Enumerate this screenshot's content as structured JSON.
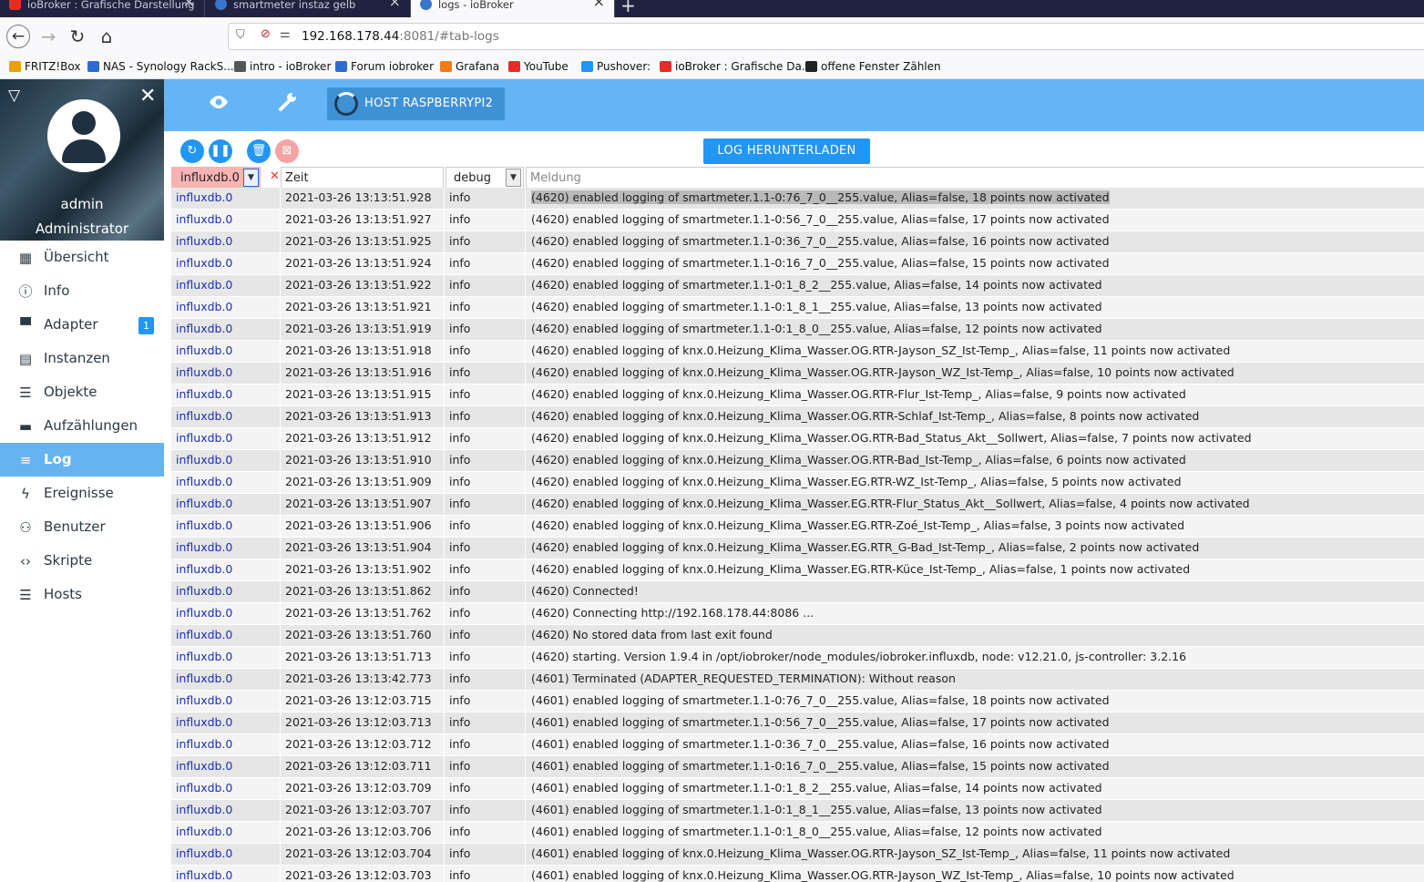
{
  "browser": {
    "tabs": [
      {
        "title": "ioBroker : Grafische Darstellung",
        "icon": "youtube-icon"
      },
      {
        "title": "smartmeter instaz gelb",
        "icon": "iobroker-icon"
      },
      {
        "title": "logs - ioBroker",
        "icon": "iobroker-icon"
      }
    ],
    "url_host": "192.168.178.44",
    "url_rest": ":8081/#tab-logs",
    "bookmarks": [
      {
        "label": "FRITZ!Box",
        "icon": "fritzbox-icon",
        "color": "#e8a100"
      },
      {
        "label": "NAS - Synology RackS...",
        "icon": "dsm-icon",
        "color": "#2d6bd1"
      },
      {
        "label": "intro - ioBroker",
        "icon": "globe-icon",
        "color": "#555555"
      },
      {
        "label": "Forum iobroker",
        "icon": "iobroker-icon",
        "color": "#2d6bd1"
      },
      {
        "label": "Grafana",
        "icon": "grafana-icon",
        "color": "#f07b1b"
      },
      {
        "label": "YouTube",
        "icon": "youtube-icon",
        "color": "#e52d27"
      },
      {
        "label": "Pushover:",
        "icon": "pushover-icon",
        "color": "#2196f3"
      },
      {
        "label": "ioBroker : Grafische Da...",
        "icon": "youtube-icon",
        "color": "#e52d27"
      },
      {
        "label": "offene Fenster Zählen",
        "icon": "github-icon",
        "color": "#222222"
      }
    ]
  },
  "sidebar": {
    "user": "admin",
    "role": "Administrator",
    "items": [
      {
        "label": "Übersicht",
        "icon": "grid-icon"
      },
      {
        "label": "Info",
        "icon": "info-icon"
      },
      {
        "label": "Adapter",
        "icon": "store-icon",
        "badge": "1"
      },
      {
        "label": "Instanzen",
        "icon": "instances-icon"
      },
      {
        "label": "Objekte",
        "icon": "list-icon"
      },
      {
        "label": "Aufzählungen",
        "icon": "enum-icon"
      },
      {
        "label": "Log",
        "icon": "log-icon",
        "active": true
      },
      {
        "label": "Ereignisse",
        "icon": "flash-icon"
      },
      {
        "label": "Benutzer",
        "icon": "user-icon"
      },
      {
        "label": "Skripte",
        "icon": "code-icon"
      },
      {
        "label": "Hosts",
        "icon": "hosts-icon"
      }
    ]
  },
  "appbar": {
    "host_label": "HOST RASPBERRYPI2"
  },
  "toolbar": {
    "download_label": "LOG HERUNTERLADEN"
  },
  "filters": {
    "source": "influxdb.0",
    "time_placeholder": "Zeit",
    "level": "debug",
    "message_placeholder": "Meldung"
  },
  "logs": [
    {
      "source": "influxdb.0",
      "time": "2021-03-26 13:13:51.928",
      "level": "info",
      "message": "(4620) enabled logging of smartmeter.1.1-0:76_7_0__255.value, Alias=false, 18 points now activated"
    },
    {
      "source": "influxdb.0",
      "time": "2021-03-26 13:13:51.927",
      "level": "info",
      "message": "(4620) enabled logging of smartmeter.1.1-0:56_7_0__255.value, Alias=false, 17 points now activated"
    },
    {
      "source": "influxdb.0",
      "time": "2021-03-26 13:13:51.925",
      "level": "info",
      "message": "(4620) enabled logging of smartmeter.1.1-0:36_7_0__255.value, Alias=false, 16 points now activated"
    },
    {
      "source": "influxdb.0",
      "time": "2021-03-26 13:13:51.924",
      "level": "info",
      "message": "(4620) enabled logging of smartmeter.1.1-0:16_7_0__255.value, Alias=false, 15 points now activated"
    },
    {
      "source": "influxdb.0",
      "time": "2021-03-26 13:13:51.922",
      "level": "info",
      "message": "(4620) enabled logging of smartmeter.1.1-0:1_8_2__255.value, Alias=false, 14 points now activated"
    },
    {
      "source": "influxdb.0",
      "time": "2021-03-26 13:13:51.921",
      "level": "info",
      "message": "(4620) enabled logging of smartmeter.1.1-0:1_8_1__255.value, Alias=false, 13 points now activated"
    },
    {
      "source": "influxdb.0",
      "time": "2021-03-26 13:13:51.919",
      "level": "info",
      "message": "(4620) enabled logging of smartmeter.1.1-0:1_8_0__255.value, Alias=false, 12 points now activated"
    },
    {
      "source": "influxdb.0",
      "time": "2021-03-26 13:13:51.918",
      "level": "info",
      "message": "(4620) enabled logging of knx.0.Heizung_Klima_Wasser.OG.RTR-Jayson_SZ_Ist-Temp_, Alias=false, 11 points now activated"
    },
    {
      "source": "influxdb.0",
      "time": "2021-03-26 13:13:51.916",
      "level": "info",
      "message": "(4620) enabled logging of knx.0.Heizung_Klima_Wasser.OG.RTR-Jayson_WZ_Ist-Temp_, Alias=false, 10 points now activated"
    },
    {
      "source": "influxdb.0",
      "time": "2021-03-26 13:13:51.915",
      "level": "info",
      "message": "(4620) enabled logging of knx.0.Heizung_Klima_Wasser.OG.RTR-Flur_Ist-Temp_, Alias=false, 9 points now activated"
    },
    {
      "source": "influxdb.0",
      "time": "2021-03-26 13:13:51.913",
      "level": "info",
      "message": "(4620) enabled logging of knx.0.Heizung_Klima_Wasser.OG.RTR-Schlaf_Ist-Temp_, Alias=false, 8 points now activated"
    },
    {
      "source": "influxdb.0",
      "time": "2021-03-26 13:13:51.912",
      "level": "info",
      "message": "(4620) enabled logging of knx.0.Heizung_Klima_Wasser.OG.RTR-Bad_Status_Akt__Sollwert, Alias=false, 7 points now activated"
    },
    {
      "source": "influxdb.0",
      "time": "2021-03-26 13:13:51.910",
      "level": "info",
      "message": "(4620) enabled logging of knx.0.Heizung_Klima_Wasser.OG.RTR-Bad_Ist-Temp_, Alias=false, 6 points now activated"
    },
    {
      "source": "influxdb.0",
      "time": "2021-03-26 13:13:51.909",
      "level": "info",
      "message": "(4620) enabled logging of knx.0.Heizung_Klima_Wasser.EG.RTR-WZ_Ist-Temp_, Alias=false, 5 points now activated"
    },
    {
      "source": "influxdb.0",
      "time": "2021-03-26 13:13:51.907",
      "level": "info",
      "message": "(4620) enabled logging of knx.0.Heizung_Klima_Wasser.EG.RTR-Flur_Status_Akt__Sollwert, Alias=false, 4 points now activated"
    },
    {
      "source": "influxdb.0",
      "time": "2021-03-26 13:13:51.906",
      "level": "info",
      "message": "(4620) enabled logging of knx.0.Heizung_Klima_Wasser.EG.RTR-Zoé_Ist-Temp_, Alias=false, 3 points now activated"
    },
    {
      "source": "influxdb.0",
      "time": "2021-03-26 13:13:51.904",
      "level": "info",
      "message": "(4620) enabled logging of knx.0.Heizung_Klima_Wasser.EG.RTR_G-Bad_Ist-Temp_, Alias=false, 2 points now activated"
    },
    {
      "source": "influxdb.0",
      "time": "2021-03-26 13:13:51.902",
      "level": "info",
      "message": "(4620) enabled logging of knx.0.Heizung_Klima_Wasser.EG.RTR-Küce_Ist-Temp_, Alias=false, 1 points now activated"
    },
    {
      "source": "influxdb.0",
      "time": "2021-03-26 13:13:51.862",
      "level": "info",
      "message": "(4620) Connected!"
    },
    {
      "source": "influxdb.0",
      "time": "2021-03-26 13:13:51.762",
      "level": "info",
      "message": "(4620) Connecting http://192.168.178.44:8086 ..."
    },
    {
      "source": "influxdb.0",
      "time": "2021-03-26 13:13:51.760",
      "level": "info",
      "message": "(4620) No stored data from last exit found"
    },
    {
      "source": "influxdb.0",
      "time": "2021-03-26 13:13:51.713",
      "level": "info",
      "message": "(4620) starting. Version 1.9.4 in /opt/iobroker/node_modules/iobroker.influxdb, node: v12.21.0, js-controller: 3.2.16"
    },
    {
      "source": "influxdb.0",
      "time": "2021-03-26 13:13:42.773",
      "level": "info",
      "message": "(4601) Terminated (ADAPTER_REQUESTED_TERMINATION): Without reason"
    },
    {
      "source": "influxdb.0",
      "time": "2021-03-26 13:12:03.715",
      "level": "info",
      "message": "(4601) enabled logging of smartmeter.1.1-0:76_7_0__255.value, Alias=false, 18 points now activated"
    },
    {
      "source": "influxdb.0",
      "time": "2021-03-26 13:12:03.713",
      "level": "info",
      "message": "(4601) enabled logging of smartmeter.1.1-0:56_7_0__255.value, Alias=false, 17 points now activated"
    },
    {
      "source": "influxdb.0",
      "time": "2021-03-26 13:12:03.712",
      "level": "info",
      "message": "(4601) enabled logging of smartmeter.1.1-0:36_7_0__255.value, Alias=false, 16 points now activated"
    },
    {
      "source": "influxdb.0",
      "time": "2021-03-26 13:12:03.711",
      "level": "info",
      "message": "(4601) enabled logging of smartmeter.1.1-0:16_7_0__255.value, Alias=false, 15 points now activated"
    },
    {
      "source": "influxdb.0",
      "time": "2021-03-26 13:12:03.709",
      "level": "info",
      "message": "(4601) enabled logging of smartmeter.1.1-0:1_8_2__255.value, Alias=false, 14 points now activated"
    },
    {
      "source": "influxdb.0",
      "time": "2021-03-26 13:12:03.707",
      "level": "info",
      "message": "(4601) enabled logging of smartmeter.1.1-0:1_8_1__255.value, Alias=false, 13 points now activated"
    },
    {
      "source": "influxdb.0",
      "time": "2021-03-26 13:12:03.706",
      "level": "info",
      "message": "(4601) enabled logging of smartmeter.1.1-0:1_8_0__255.value, Alias=false, 12 points now activated"
    },
    {
      "source": "influxdb.0",
      "time": "2021-03-26 13:12:03.704",
      "level": "info",
      "message": "(4601) enabled logging of knx.0.Heizung_Klima_Wasser.OG.RTR-Jayson_SZ_Ist-Temp_, Alias=false, 11 points now activated"
    },
    {
      "source": "influxdb.0",
      "time": "2021-03-26 13:12:03.703",
      "level": "info",
      "message": "(4601) enabled logging of knx.0.Heizung_Klima_Wasser.OG.RTR-Jayson_WZ_Ist-Temp_, Alias=false, 10 points now activated"
    }
  ]
}
